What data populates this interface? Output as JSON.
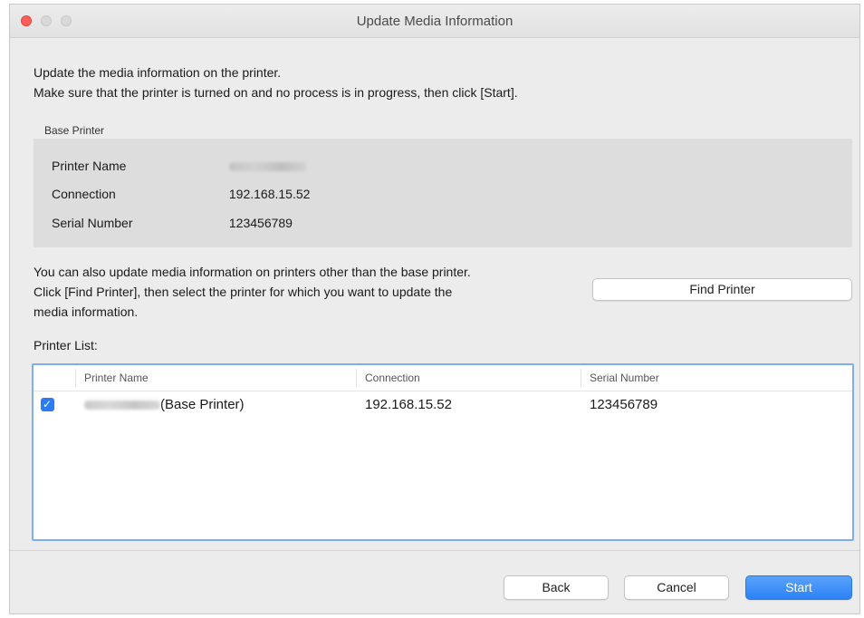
{
  "window": {
    "title": "Update Media Information"
  },
  "intro": {
    "line1": "Update the media information on the printer.",
    "line2": "Make sure that the printer is turned on and no process is in progress, then click [Start]."
  },
  "base_printer": {
    "label": "Base Printer",
    "fields": [
      {
        "key": "Printer Name",
        "value": ""
      },
      {
        "key": "Connection",
        "value": "192.168.15.52"
      },
      {
        "key": "Serial Number",
        "value": "123456789"
      }
    ]
  },
  "other_printers": {
    "text_line1": "You can also update media information on printers other than the base printer.",
    "text_line2": "Click [Find Printer], then select the printer for which you want to update the",
    "text_line3": "media information.",
    "find_button": "Find Printer"
  },
  "printer_list": {
    "label": "Printer List:",
    "columns": [
      "Printer Name",
      "Connection",
      "Serial Number"
    ],
    "rows": [
      {
        "checked": true,
        "name_suffix": "(Base Printer)",
        "connection": "192.168.15.52",
        "serial": "123456789"
      }
    ]
  },
  "footer": {
    "back": "Back",
    "cancel": "Cancel",
    "start": "Start"
  },
  "colors": {
    "accent": "#2c82f5",
    "close": "#fc5f57",
    "list_border": "#7faef0"
  }
}
